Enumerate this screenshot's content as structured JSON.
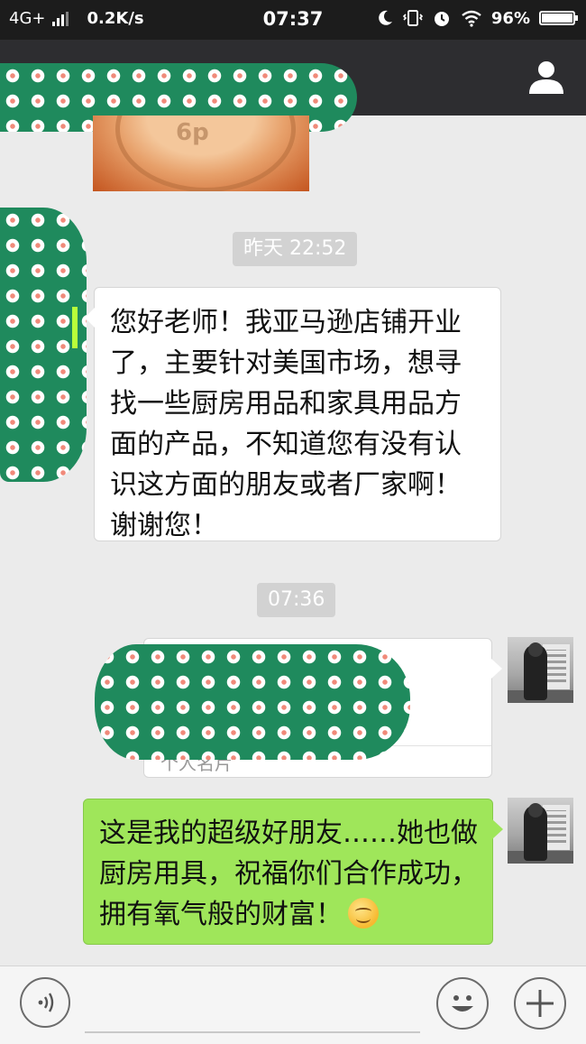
{
  "status_bar": {
    "network": "4G+",
    "speed": "0.2K/s",
    "time": "07:37",
    "battery": "96%",
    "battery_level": 0.96
  },
  "chat": {
    "timestamps": [
      "昨天 22:52",
      "07:36"
    ],
    "messages": [
      {
        "direction": "incoming",
        "text": "您好老师！我亚马逊店铺开业了，主要针对美国市场，想寻找一些厨房用品和家具用品方面的产品，不知道您有没有认识这方面的朋友或者厂家啊！谢谢您！"
      },
      {
        "direction": "outgoing",
        "type": "contact-card",
        "card_label": "个人名片"
      },
      {
        "direction": "outgoing",
        "text": "这是我的超级好朋友……她也做厨房用具，祝福你们合作成功，拥有氧气般的财富！"
      }
    ]
  },
  "icons": {
    "profile": "person-icon",
    "voice": "voice-icon",
    "emoji": "smiley-icon",
    "add": "plus-icon"
  },
  "colors": {
    "status_bar_bg": "#1c1c1c",
    "title_bar_bg": "#2d2d30",
    "chat_bg": "#ebebeb",
    "outgoing_bubble": "#9fe65a",
    "incoming_bubble": "#ffffff",
    "redaction_green": "#1f8a5d"
  }
}
